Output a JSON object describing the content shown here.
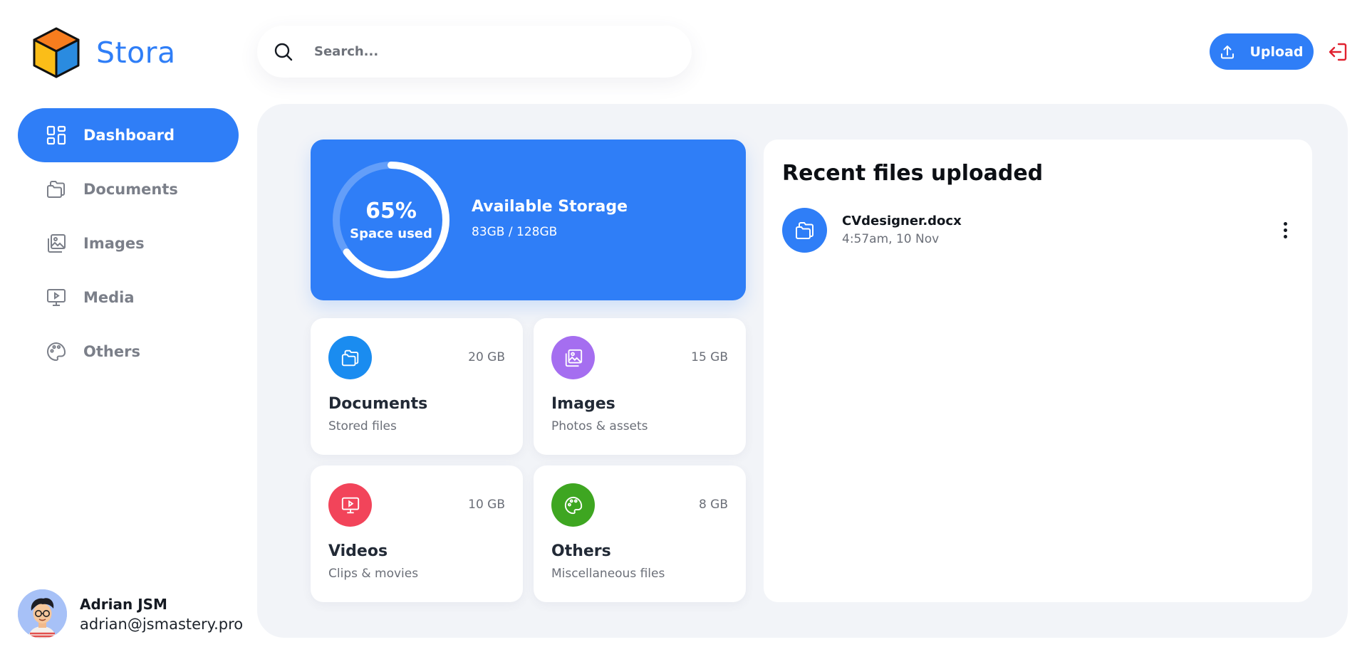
{
  "brand": {
    "name": "Stora",
    "logo_icon": "cube-logo-icon"
  },
  "search": {
    "placeholder": "Search...",
    "icon": "search-icon"
  },
  "header": {
    "upload_label": "Upload",
    "upload_icon": "upload-icon",
    "logout_icon": "logout-icon"
  },
  "sidebar": {
    "items": [
      {
        "label": "Dashboard",
        "icon": "dashboard-icon",
        "active": true
      },
      {
        "label": "Documents",
        "icon": "documents-icon",
        "active": false
      },
      {
        "label": "Images",
        "icon": "images-icon",
        "active": false
      },
      {
        "label": "Media",
        "icon": "media-icon",
        "active": false
      },
      {
        "label": "Others",
        "icon": "palette-icon",
        "active": false
      }
    ]
  },
  "user": {
    "name": "Adrian JSM",
    "email": "adrian@jsmastery.pro"
  },
  "storage": {
    "percent_label": "65%",
    "percent_value": 65,
    "used_label": "Space used",
    "title": "Available Storage",
    "usage": "83GB / 128GB"
  },
  "categories": [
    {
      "name": "Documents",
      "desc": "Stored files",
      "size": "20 GB",
      "color": "#1a8cf0",
      "icon": "folder-icon"
    },
    {
      "name": "Images",
      "desc": "Photos & assets",
      "size": "15 GB",
      "color": "#a56ef0",
      "icon": "images-icon"
    },
    {
      "name": "Videos",
      "desc": "Clips & movies",
      "size": "10 GB",
      "color": "#f2445a",
      "icon": "video-icon"
    },
    {
      "name": "Others",
      "desc": "Miscellaneous files",
      "size": "8 GB",
      "color": "#3ea621",
      "icon": "palette-icon"
    }
  ],
  "recent": {
    "title": "Recent files uploaded",
    "files": [
      {
        "name": "CVdesigner.docx",
        "date": "4:57am, 10 Nov",
        "icon": "folder-icon"
      }
    ]
  },
  "colors": {
    "accent": "#2f7ef7",
    "panel_bg": "#f2f4f8",
    "logout": "#e0212f"
  }
}
